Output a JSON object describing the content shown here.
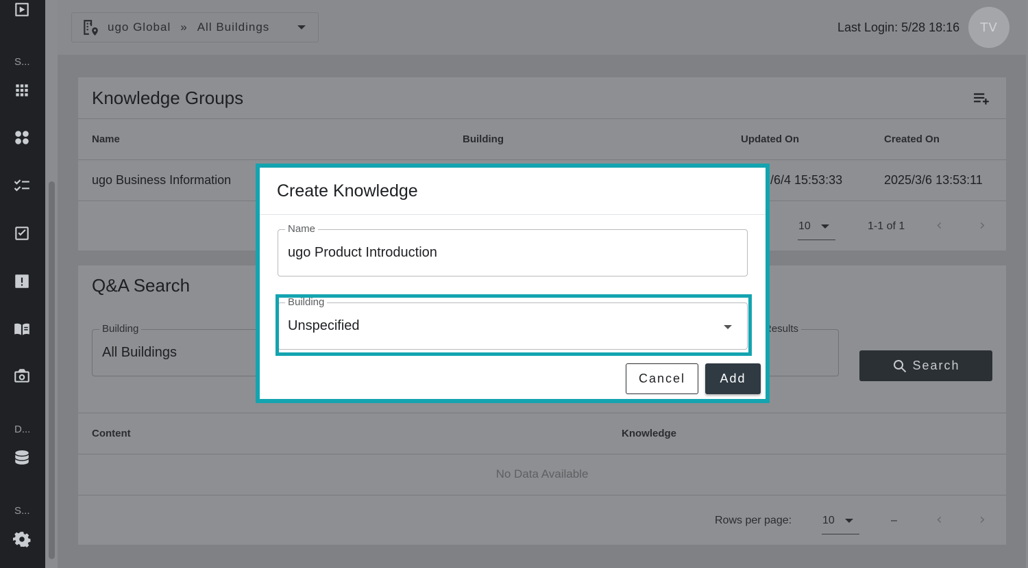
{
  "sidebar": {
    "section_labels": [
      "S...",
      "D...",
      "S..."
    ],
    "icons": [
      "play-square-icon",
      "apps-grid-icon",
      "widgets-icon",
      "checklist-icon",
      "task-check-icon",
      "alert-icon",
      "book-icon",
      "camera-icon",
      "database-icon",
      "gear-icon"
    ]
  },
  "header": {
    "org": "ugo Global",
    "separator": "»",
    "building": "All Buildings",
    "last_login": "Last Login: 5/28 18:16",
    "avatar_initials": "TV"
  },
  "knowledge_groups": {
    "title": "Knowledge Groups",
    "columns": [
      "Name",
      "Building",
      "Updated On",
      "Created On"
    ],
    "rows": [
      {
        "name": "ugo Business Information",
        "updated_on": "/6/4 15:53:33",
        "created_on": "2025/3/6 13:53:11"
      }
    ],
    "rows_per_page": "10",
    "range": "1-1 of 1"
  },
  "qa_search": {
    "title": "Q&A Search",
    "building_label": "Building",
    "building_value": "All Buildings",
    "results_label": "Results",
    "search_label": "Search",
    "columns": [
      "Content",
      "Knowledge"
    ],
    "empty_text": "No Data Available",
    "rows_per_page_label": "Rows per page:",
    "rows_per_page": "10",
    "range": "–"
  },
  "modal": {
    "title": "Create Knowledge",
    "name_label": "Name",
    "name_value": "ugo Product Introduction",
    "building_label": "Building",
    "building_value": "Unspecified",
    "cancel_label": "Cancel",
    "add_label": "Add"
  },
  "colors": {
    "highlight": "#13a4b0",
    "primary_button": "#2f3a43",
    "sidebar": "#1f2124"
  }
}
